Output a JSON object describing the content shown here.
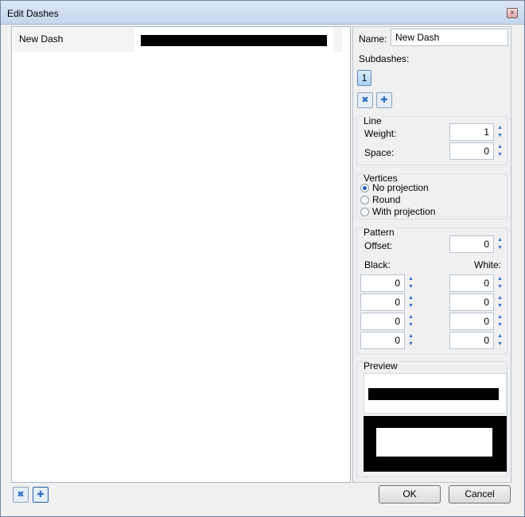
{
  "window": {
    "title": "Edit Dashes",
    "close_glyph": "×"
  },
  "list": {
    "rows": [
      {
        "name": "New Dash"
      }
    ]
  },
  "right": {
    "name_label": "Name:",
    "name_value": "New Dash",
    "subdashes_label": "Subdashes:",
    "subdash_selected": "1",
    "line": {
      "label": "Line",
      "weight_label": "Weight:",
      "weight_value": "1",
      "space_label": "Space:",
      "space_value": "0"
    },
    "vertices": {
      "label": "Vertices",
      "options": [
        "No projection",
        "Round",
        "With projection"
      ],
      "selected": "No projection"
    },
    "pattern": {
      "label": "Pattern",
      "offset_label": "Offset:",
      "offset_value": "0",
      "black_label": "Black:",
      "white_label": "White:",
      "black_values": [
        "0",
        "0",
        "0",
        "0"
      ],
      "white_values": [
        "0",
        "0",
        "0",
        "0"
      ]
    },
    "preview_label": "Preview"
  },
  "buttons": {
    "ok": "OK",
    "cancel": "Cancel"
  },
  "icons": {
    "delete": "delete-dash-icon",
    "add": "add-dash-icon",
    "spin_up": "▲",
    "spin_down": "▼"
  }
}
